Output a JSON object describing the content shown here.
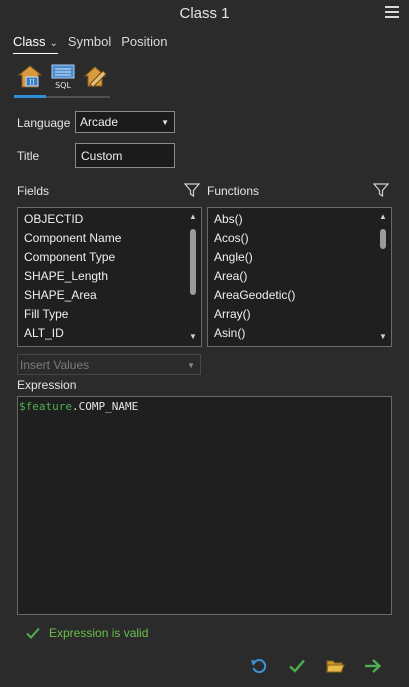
{
  "window": {
    "title": "Class 1"
  },
  "tabs": [
    {
      "label": "Class",
      "active": true
    },
    {
      "label": "Symbol",
      "active": false
    },
    {
      "label": "Position",
      "active": false
    }
  ],
  "toolbar": {
    "icons": [
      "label-class-properties-icon",
      "sql-query-icon",
      "label-placement-icon"
    ],
    "sql_text": "SQL"
  },
  "form": {
    "language_label": "Language",
    "language_value": "Arcade",
    "title_label": "Title",
    "title_value": "Custom"
  },
  "fields": {
    "label": "Fields",
    "items": [
      "OBJECTID",
      "Component Name",
      "Component Type",
      "SHAPE_Length",
      "SHAPE_Area",
      "Fill Type",
      "ALT_ID"
    ]
  },
  "functions": {
    "label": "Functions",
    "items": [
      "Abs()",
      "Acos()",
      "Angle()",
      "Area()",
      "AreaGeodetic()",
      "Array()",
      "Asin()"
    ]
  },
  "insert_values": {
    "placeholder": "Insert Values"
  },
  "expression": {
    "label": "Expression",
    "keyword": "$feature",
    "rest": ".COMP_NAME"
  },
  "status": {
    "message": "Expression is valid",
    "color": "#6abf4b"
  },
  "colors": {
    "accent": "#2f8fd6",
    "valid": "#4caf50",
    "folder": "#e0b24a"
  }
}
